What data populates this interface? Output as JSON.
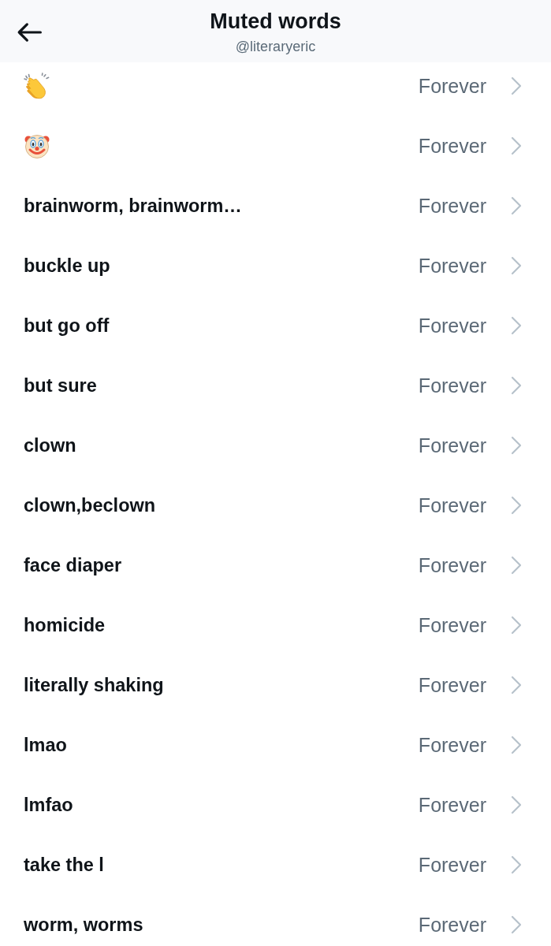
{
  "header": {
    "title": "Muted words",
    "subtitle": "@literaryeric"
  },
  "muted_words": [
    {
      "kind": "clapping-emoji",
      "duration": "Forever"
    },
    {
      "kind": "clown-emoji",
      "duration": "Forever"
    },
    {
      "kind": "text",
      "word": "brainworm, brainworm…",
      "duration": "Forever"
    },
    {
      "kind": "text",
      "word": "buckle up",
      "duration": "Forever"
    },
    {
      "kind": "text",
      "word": "but go off",
      "duration": "Forever"
    },
    {
      "kind": "text",
      "word": "but sure",
      "duration": "Forever"
    },
    {
      "kind": "text",
      "word": "clown",
      "duration": "Forever"
    },
    {
      "kind": "text",
      "word": "clown,beclown",
      "duration": "Forever"
    },
    {
      "kind": "text",
      "word": "face diaper",
      "duration": "Forever"
    },
    {
      "kind": "text",
      "word": "homicide",
      "duration": "Forever"
    },
    {
      "kind": "text",
      "word": "literally shaking",
      "duration": "Forever"
    },
    {
      "kind": "text",
      "word": "lmao",
      "duration": "Forever"
    },
    {
      "kind": "text",
      "word": "lmfao",
      "duration": "Forever"
    },
    {
      "kind": "text",
      "word": "take the l",
      "duration": "Forever"
    },
    {
      "kind": "text",
      "word": "worm, worms",
      "duration": "Forever"
    }
  ]
}
